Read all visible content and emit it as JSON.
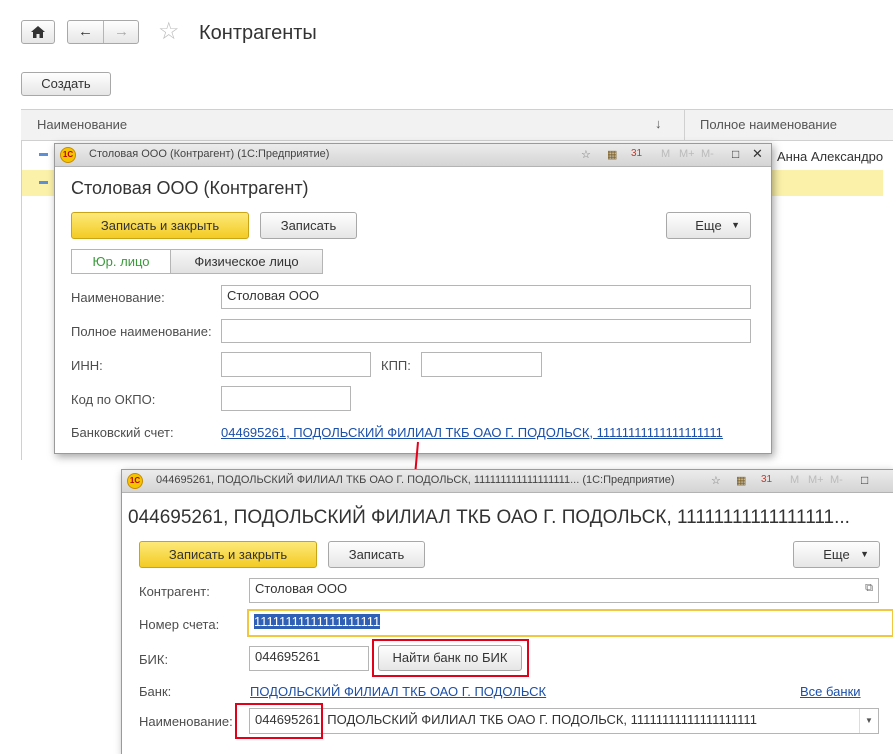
{
  "main": {
    "title": "Контрагенты",
    "create_label": "Создать",
    "columns": [
      "Наименование",
      "Полное наименование"
    ],
    "sort_icon": "↓",
    "row1_fullname": "Анна Александро"
  },
  "form1": {
    "titlebar": "Столовая ООО (Контрагент)  (1С:Предприятие)",
    "heading": "Столовая ООО (Контрагент)",
    "save_close": "Записать и закрыть",
    "save": "Записать",
    "more": "Еще",
    "tabs": [
      "Юр. лицо",
      "Физическое лицо"
    ],
    "labels": {
      "name": "Наименование:",
      "fullname": "Полное наименование:",
      "inn": "ИНН:",
      "kpp": "КПП:",
      "okpo": "Код по ОКПО:",
      "bank_account": "Банковский счет:"
    },
    "values": {
      "name": "Столовая ООО",
      "fullname": "",
      "inn": "",
      "kpp": "",
      "okpo": "",
      "bank_account": "044695261, ПОДОЛЬСКИЙ ФИЛИАЛ ТКБ ОАО Г. ПОДОЛЬСК, 11111111111111111111"
    },
    "tb_icons": [
      "☆",
      "▦",
      "31",
      "M",
      "M+",
      "M-",
      "□",
      "✕"
    ]
  },
  "form2": {
    "titlebar": "044695261, ПОДОЛЬСКИЙ ФИЛИАЛ ТКБ ОАО Г. ПОДОЛЬСК, 111111111111111111...  (1С:Предприятие)",
    "heading": "044695261, ПОДОЛЬСКИЙ ФИЛИАЛ ТКБ ОАО Г. ПОДОЛЬСК, 11111111111111111...",
    "save_close": "Записать и закрыть",
    "save": "Записать",
    "more": "Еще",
    "labels": {
      "counterparty": "Контрагент:",
      "account": "Номер счета:",
      "bik": "БИК:",
      "bank": "Банк:",
      "name": "Наименование:"
    },
    "values": {
      "counterparty": "Столовая ООО",
      "account": "11111111111111111111",
      "bik": "044695261",
      "bank": "ПОДОЛЬСКИЙ ФИЛИАЛ ТКБ ОАО Г. ПОДОЛЬСК",
      "name_bik": "044695261",
      "name_rest": ", ПОДОЛЬСКИЙ ФИЛИАЛ ТКБ ОАО Г. ПОДОЛЬСК, 11111111111111111111"
    },
    "find_bank": "Найти банк по БИК",
    "all_banks": "Все банки",
    "tb_icons": [
      "☆",
      "▦",
      "31",
      "M",
      "M+",
      "M-",
      "□"
    ]
  },
  "colors": {
    "accent_red": "#e3001b",
    "link": "#1b4fa8",
    "yellow": "#f3cb23"
  }
}
